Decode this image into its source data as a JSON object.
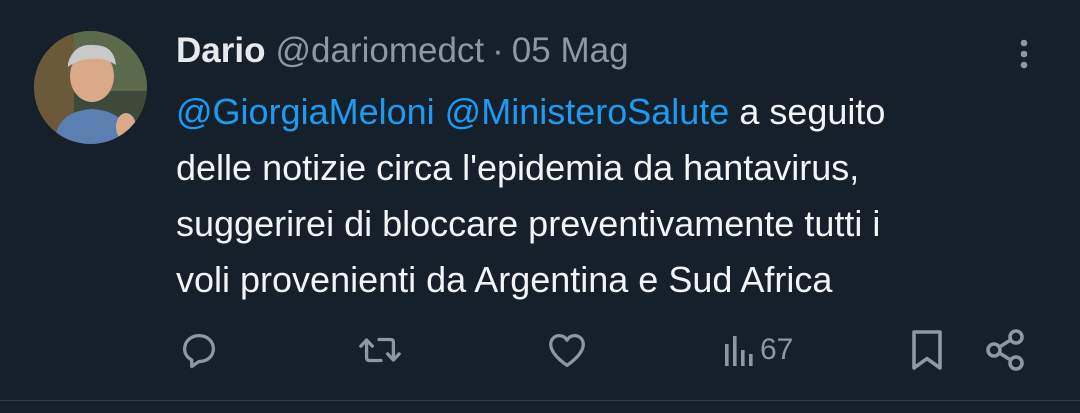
{
  "author": {
    "name": "Dario",
    "handle": "@dariomedct",
    "separator": "·",
    "date": "05 Mag"
  },
  "tweet": {
    "mention_1": "@GiorgiaMeloni",
    "mention_2": "@MinisteroSalute",
    "line_1_rest": " a seguito",
    "line_2": "delle notizie circa l'epidemia da hantavirus,",
    "line_3": "suggerirei di bloccare preventivamente tutti i",
    "line_4": "voli provenienti da Argentina e Sud Africa"
  },
  "actions": {
    "views_count": "67"
  },
  "icons": {
    "avatar": "avatar",
    "more": "more-vertical-icon",
    "reply": "reply-icon",
    "retweet": "retweet-icon",
    "like": "heart-icon",
    "views": "views-chart-icon",
    "bookmark": "bookmark-icon",
    "share": "share-icon"
  },
  "colors": {
    "background": "#15202b",
    "text": "#e7e9ea",
    "secondary": "#8b98a5",
    "link": "#1d9bf0"
  }
}
